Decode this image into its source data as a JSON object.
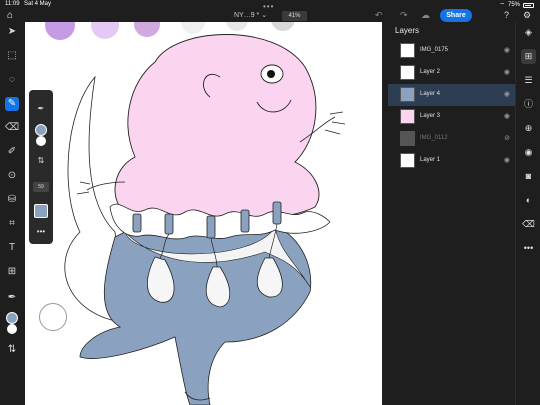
{
  "status_bar": {
    "time": "11:09",
    "date": "Sat 4 May",
    "battery": "75%"
  },
  "top_bar": {
    "doc_title": "NY…9 *",
    "doc_chevron": "⌄",
    "zoom": "41%",
    "share_label": "Share",
    "help_glyph": "?",
    "icons": [
      "home-icon",
      "undo-icon",
      "redo-icon",
      "cloud-icon",
      "help-icon",
      "settings-icon"
    ]
  },
  "left_tools": {
    "items": [
      {
        "name": "select-tool",
        "glyph": "➤"
      },
      {
        "name": "transform-tool",
        "glyph": "⬚"
      },
      {
        "name": "lasso-tool",
        "glyph": "◌"
      },
      {
        "name": "brush-tool",
        "glyph": "✎"
      },
      {
        "name": "eraser-tool",
        "glyph": "⌫"
      },
      {
        "name": "smudge-tool",
        "glyph": "✐"
      },
      {
        "name": "clone-tool",
        "glyph": "⊙"
      },
      {
        "name": "fill-tool",
        "glyph": "⛁"
      },
      {
        "name": "crop-tool",
        "glyph": "⌗"
      },
      {
        "name": "type-tool",
        "glyph": "T"
      },
      {
        "name": "place-image-tool",
        "glyph": "⊞"
      },
      {
        "name": "eyedropper-tool",
        "glyph": "✒"
      }
    ],
    "primary_color": "#8aa2c0",
    "secondary_color": "#ffffff",
    "swap_glyph": "⇅"
  },
  "brush_panel": {
    "size_value": "59",
    "color": "#8aa2c0"
  },
  "layers": {
    "title": "Layers",
    "items": [
      {
        "name": "IMG_0175",
        "selected": false,
        "dim": false,
        "visible": true
      },
      {
        "name": "Layer 2",
        "selected": false,
        "dim": false,
        "visible": true
      },
      {
        "name": "Layer 4",
        "selected": true,
        "dim": false,
        "visible": true
      },
      {
        "name": "Layer 3",
        "selected": false,
        "dim": false,
        "visible": true
      },
      {
        "name": "IMG_0112",
        "selected": false,
        "dim": true,
        "visible": false
      },
      {
        "name": "Layer 1",
        "selected": false,
        "dim": false,
        "visible": true
      }
    ]
  },
  "right_rail": {
    "items": [
      "layers-icon",
      "add-layer-icon",
      "adjustments-icon",
      "info-icon",
      "add-icon",
      "visibility-icon",
      "mask-icon",
      "fx-icon",
      "more-icon"
    ]
  },
  "colors": {
    "accent": "#1473e6",
    "creature_pink": "#fbd4ef",
    "creature_blue": "#8aa2c0"
  }
}
